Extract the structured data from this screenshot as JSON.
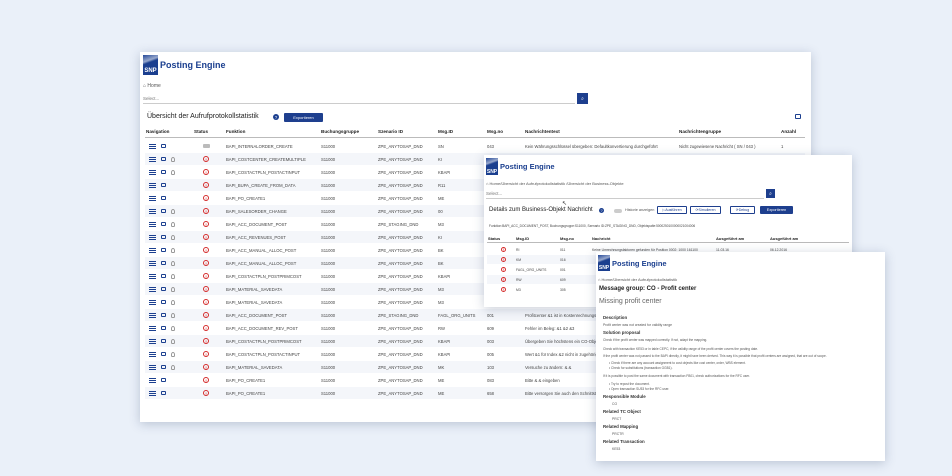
{
  "brand": {
    "mark": "SNP",
    "name": "Posting Engine"
  },
  "w1": {
    "breadcrumb": "Home",
    "search_placeholder": "Select...",
    "title": "Übersicht der Aufrufprotokollstatistik",
    "export_label": "Exportieren",
    "columns": [
      "Navigation",
      "Status",
      "Funktion",
      "Buchungsgruppe",
      "Szenario ID",
      "Msg.ID",
      "Msg.no",
      "Nachrichtentext",
      "Nachrichtengruppe",
      "Anzahl"
    ],
    "rows": [
      {
        "func": "BAPI_INTERNALORDER_CREATE",
        "grp": "S11000",
        "scen": "ZPE_ANYTOSAP_DND",
        "msgid": "SN",
        "msgno": "043",
        "text": "Kein Währungsschlüssel übergeben: Defaultkonvertierung durchgeführt",
        "mgroup": "Nicht zugewiesene Nachricht ( SN / 043 )",
        "count": "1",
        "status": "info",
        "bulb": false
      },
      {
        "func": "BAPI_COSTCENTER_CREATEMULTIPLE",
        "grp": "S11000",
        "scen": "ZPE_ANYTOSAP_DND",
        "msgid": "KI",
        "msgno": "",
        "text": "",
        "mgroup": "",
        "count": "",
        "status": "err",
        "bulb": true
      },
      {
        "func": "BAPI_COSTACTPLN_POSTACTINPUT",
        "grp": "S11000",
        "scen": "ZPE_ANYTOSAP_DND",
        "msgid": "KBAPI",
        "msgno": "",
        "text": "",
        "mgroup": "",
        "count": "",
        "status": "err",
        "bulb": true
      },
      {
        "func": "BAPI_BUPA_CREATE_FROM_DATA",
        "grp": "S11000",
        "scen": "ZPE_ANYTOSAP_DND",
        "msgid": "R11",
        "msgno": "",
        "text": "",
        "mgroup": "",
        "count": "",
        "status": "err",
        "bulb": false
      },
      {
        "func": "BAPI_PO_CREATE1",
        "grp": "S11000",
        "scen": "ZPE_ANYTOSAP_DND",
        "msgid": "ME",
        "msgno": "",
        "text": "",
        "mgroup": "",
        "count": "",
        "status": "err",
        "bulb": false
      },
      {
        "func": "BAPI_SALESORDER_CHANGE",
        "grp": "S11000",
        "scen": "ZPE_ANYTOSAP_DND",
        "msgid": "00",
        "msgno": "",
        "text": "",
        "mgroup": "",
        "count": "",
        "status": "err",
        "bulb": true
      },
      {
        "func": "BAPI_ACC_DOCUMENT_POST",
        "grp": "S11000",
        "scen": "ZPE_STAGING_DND",
        "msgid": "M3",
        "msgno": "",
        "text": "",
        "mgroup": "",
        "count": "",
        "status": "err",
        "bulb": true
      },
      {
        "func": "BAPI_ACC_REVENUES_POST",
        "grp": "S11000",
        "scen": "ZPE_ANYTOSAP_DND",
        "msgid": "KI",
        "msgno": "",
        "text": "",
        "mgroup": "",
        "count": "",
        "status": "err",
        "bulb": true
      },
      {
        "func": "BAPI_ACC_MANUAL_ALLOC_POST",
        "grp": "S11000",
        "scen": "ZPE_ANYTOSAP_DND",
        "msgid": "BK",
        "msgno": "",
        "text": "",
        "mgroup": "",
        "count": "",
        "status": "err",
        "bulb": true
      },
      {
        "func": "BAPI_ACC_MANUAL_ALLOC_POST",
        "grp": "S11000",
        "scen": "ZPE_ANYTOSAP_DND",
        "msgid": "BK",
        "msgno": "",
        "text": "",
        "mgroup": "",
        "count": "",
        "status": "err",
        "bulb": true
      },
      {
        "func": "BAPI_COSTACTPLN_POSTPRIMCOST",
        "grp": "S11000",
        "scen": "ZPE_ANYTOSAP_DND",
        "msgid": "KBAPI",
        "msgno": "",
        "text": "",
        "mgroup": "",
        "count": "",
        "status": "err",
        "bulb": true
      },
      {
        "func": "BAPI_MATERIAL_SAVEDATA",
        "grp": "S11000",
        "scen": "ZPE_ANYTOSAP_DND",
        "msgid": "M3",
        "msgno": "",
        "text": "",
        "mgroup": "",
        "count": "",
        "status": "err",
        "bulb": true
      },
      {
        "func": "BAPI_MATERIAL_SAVEDATA",
        "grp": "S11000",
        "scen": "ZPE_ANYTOSAP_DND",
        "msgid": "M3",
        "msgno": "",
        "text": "",
        "mgroup": "",
        "count": "",
        "status": "err",
        "bulb": true
      },
      {
        "func": "BAPI_ACC_DOCUMENT_POST",
        "grp": "S11000",
        "scen": "ZPE_STAGING_DND",
        "msgid": "FAGL_ORG_UNITS",
        "msgno": "001",
        "text": "Profitcenter &1 ist in Kostenrechnungskreis",
        "mgroup": "",
        "count": "",
        "status": "err",
        "bulb": true
      },
      {
        "func": "BAPI_ACC_DOCUMENT_REV_POST",
        "grp": "S11000",
        "scen": "ZPE_ANYTOSAP_DND",
        "msgid": "RW",
        "msgno": "609",
        "text": "Fehler im Beleg: &1 &2 &3",
        "mgroup": "",
        "count": "",
        "status": "err",
        "bulb": true
      },
      {
        "func": "BAPI_COSTACTPLN_POSTPRIMCOST",
        "grp": "S11000",
        "scen": "ZPE_ANYTOSAP_DND",
        "msgid": "KBAPI",
        "msgno": "003",
        "text": "Übergeben Sie höchstens ein CO-Objekt",
        "mgroup": "",
        "count": "",
        "status": "err",
        "bulb": true
      },
      {
        "func": "BAPI_COSTACTPLN_POSTACTINPUT",
        "grp": "S11000",
        "scen": "ZPE_ANYTOSAP_DND",
        "msgid": "KBAPI",
        "msgno": "005",
        "text": "Wert &1 für Index &2 nicht in zugehörigem",
        "mgroup": "",
        "count": "",
        "status": "err",
        "bulb": true
      },
      {
        "func": "BAPI_MATERIAL_SAVEDATA",
        "grp": "S11000",
        "scen": "ZPE_ANYTOSAP_DND",
        "msgid": "MK",
        "msgno": "103",
        "text": "Versuche zu ändern: & &",
        "mgroup": "",
        "count": "",
        "status": "err",
        "bulb": true
      },
      {
        "func": "BAPI_PO_CREATE1",
        "grp": "S11000",
        "scen": "ZPE_ANYTOSAP_DND",
        "msgid": "ME",
        "msgno": "083",
        "text": "Bitte & & eingeben",
        "mgroup": "",
        "count": "",
        "status": "err",
        "bulb": false
      },
      {
        "func": "BAPI_PO_CREATE1",
        "grp": "S11000",
        "scen": "ZPE_ANYTOSAP_DND",
        "msgid": "ME",
        "msgno": "658",
        "text": "Bitte versorgen Sie auch den Schnittstellenparameter",
        "mgroup": "",
        "count": "",
        "status": "err",
        "bulb": false
      }
    ]
  },
  "w2": {
    "breadcrumb": "Home/Übersicht der Aufrufprotokollstatistik /Übersicht der Business-Objekte",
    "search_placeholder": "Select...",
    "title": "Details zum Business-Objekt Nachricht",
    "toggle_label": "Historie anzeigen",
    "buttons": [
      "Ausführen",
      "Simulieren",
      "Debug",
      "Exportieren"
    ],
    "info": "Funktion:BAPI_ACC_DOCUMENT_POST, Buchungsgruppe:S11000, Szenario ID:ZPE_STAGING_DND, Objektspalte:5000250100000021004006",
    "columns": [
      "Status",
      "Msg.ID",
      "Msg.no",
      "Nachricht",
      "Ausgeführt am",
      "Ausgeführt am"
    ],
    "rows": [
      {
        "id": "RI",
        "no": "011",
        "text": "Keine Umrechnungsfaktoren gefunden für Position 0002: 1000 161100",
        "d1": "11.03.16",
        "d2": "06.12.2016"
      },
      {
        "id": "KM",
        "no": "016",
        "text": "",
        "d1": "",
        "d2": ""
      },
      {
        "id": "FAGL_ORG_UNITS",
        "no": "001",
        "text": "",
        "d1": "",
        "d2": ""
      },
      {
        "id": "RW",
        "no": "609",
        "text": "",
        "d1": "",
        "d2": ""
      },
      {
        "id": "M3",
        "no": "305",
        "text": "",
        "d1": "",
        "d2": ""
      }
    ]
  },
  "w3": {
    "breadcrumb": "Home/Übersicht der Aufrufprotokollstatistik",
    "title": "Message group: CO - Profit center",
    "subtitle": "Missing profit center",
    "desc_head": "Description",
    "desc_text": "Profit center was not created for validity range",
    "sol_head": "Solution proposal",
    "sol_lines": [
      "Check if the profit center was mapped correctly. If not, adapt the mapping.",
      "Check with transaction KE53 or in table CEPC, if the validity range of the profit center covers the posting date.",
      "If the profit center was not passed to the BAPI directly, it might have been derived. This way it is possible that profit centers are assigned, that are out of scope.",
      "Check if there are any account assignment to cost objects like cost center, order, WBS element.",
      "Check for substitutions (transaction GGB1).",
      "If it is possible to post the same document with transaction FB01, check authorizations for the RFC user.",
      "Try to repost the document.",
      "Open transaction SU53 for the RFC user."
    ],
    "sections": [
      {
        "head": "Responsible Module",
        "value": "CO"
      },
      {
        "head": "Related TC Object",
        "value": "PRCT"
      },
      {
        "head": "Related Mapping",
        "value": "PRCTR"
      },
      {
        "head": "Related Transaction",
        "value": "KE53"
      }
    ]
  }
}
